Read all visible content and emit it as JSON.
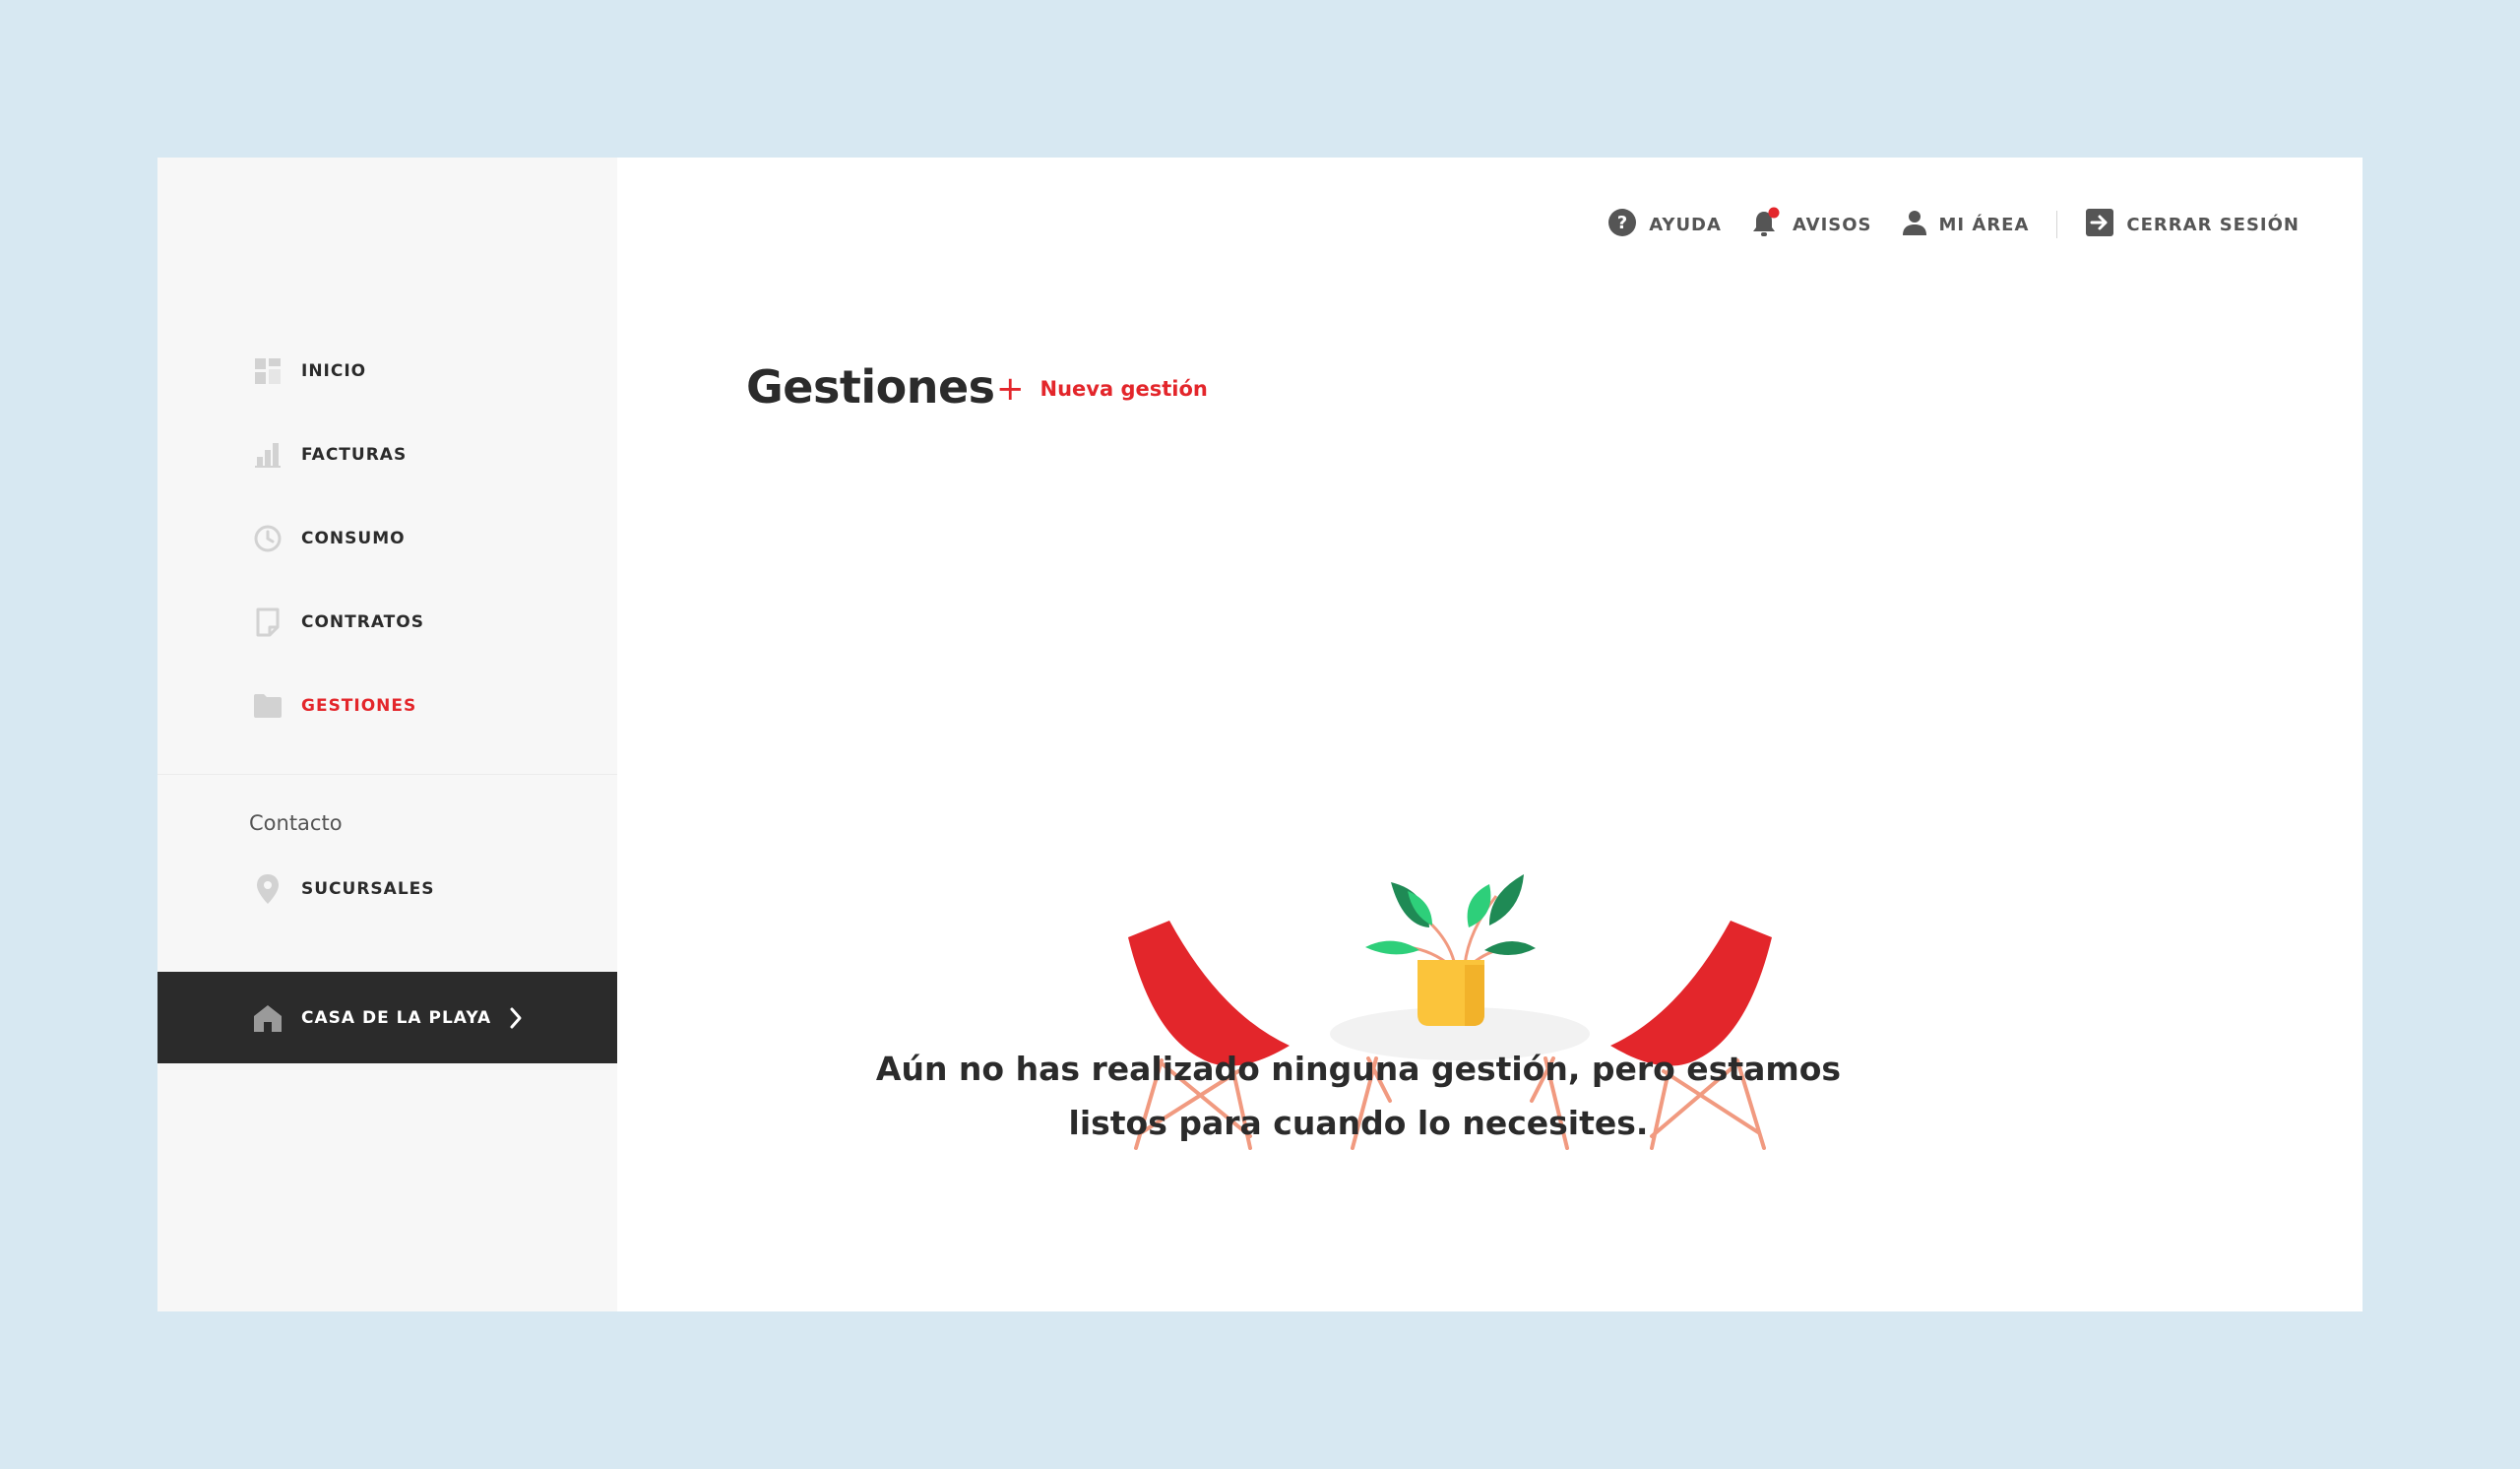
{
  "sidebar": {
    "items": [
      {
        "label": "INICIO",
        "icon": "dashboard-icon"
      },
      {
        "label": "FACTURAS",
        "icon": "bar-chart-icon"
      },
      {
        "label": "CONSUMO",
        "icon": "clock-icon"
      },
      {
        "label": "CONTRATOS",
        "icon": "document-icon"
      },
      {
        "label": "GESTIONES",
        "icon": "folder-icon"
      }
    ],
    "contact_section_label": "Contacto",
    "contact_items": [
      {
        "label": "SUCURSALES",
        "icon": "location-pin-icon"
      }
    ],
    "property": {
      "label": "CASA DE LA PLAYA",
      "icon": "home-icon"
    }
  },
  "header": {
    "help_label": "AYUDA",
    "notices_label": "AVISOS",
    "my_area_label": "MI ÁREA",
    "logout_label": "CERRAR SESIÓN"
  },
  "main": {
    "title": "Gestiones",
    "new_button_label": "Nueva gestión",
    "empty_message_line1": "Aún no has realizado ninguna gestión, pero estamos",
    "empty_message_line2": "listos para cuando lo necesites."
  },
  "colors": {
    "accent": "#e3262b",
    "dark": "#2b2b2b",
    "background": "#d7e8f2",
    "sidebar_bg": "#f7f7f7",
    "chair": "#e3262b",
    "chair_legs": "#f19a80",
    "pot": "#fbc43b",
    "leaf_dark": "#1f8a55",
    "leaf_light": "#2ecf7a"
  }
}
